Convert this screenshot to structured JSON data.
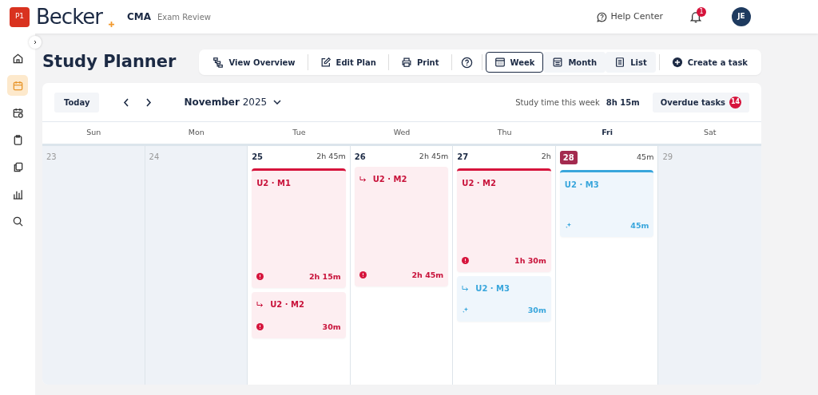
{
  "header": {
    "badge": "P1",
    "logo": "Becker",
    "product": "CMA",
    "product_subtitle": "Exam Review",
    "help": "Help Center",
    "notifications": "1",
    "avatar": "JE"
  },
  "sidebar": {
    "items": [
      {
        "selected": false
      },
      {
        "selected": true
      },
      {
        "selected": false
      },
      {
        "selected": false
      },
      {
        "selected": false
      },
      {
        "selected": false
      },
      {
        "selected": false
      }
    ]
  },
  "title": "Study Planner",
  "toolbar": [
    {
      "kind": "action",
      "label": "View Overview"
    },
    {
      "kind": "action",
      "label": "Edit Plan"
    },
    {
      "kind": "action",
      "label": "Print"
    },
    {
      "kind": "help"
    },
    {
      "kind": "view",
      "label": "Week",
      "selected": true
    },
    {
      "kind": "view",
      "label": "Month",
      "selected": false
    },
    {
      "kind": "view",
      "label": "List",
      "selected": false
    },
    {
      "kind": "create",
      "label": "Create a task"
    }
  ],
  "calendar": {
    "today_button": "Today",
    "month": "November",
    "year": "2025",
    "study_time_label": "Study time this week",
    "study_time": "8h 15m",
    "overdue_label": "Overdue tasks",
    "overdue_count": "14",
    "weekdays": [
      {
        "label": "Sun",
        "selected": false
      },
      {
        "label": "Mon",
        "selected": false
      },
      {
        "label": "Tue",
        "selected": false
      },
      {
        "label": "Wed",
        "selected": false
      },
      {
        "label": "Thu",
        "selected": false
      },
      {
        "label": "Fri",
        "selected": true
      },
      {
        "label": "Sat",
        "selected": false
      }
    ],
    "days": [
      {
        "date": "23",
        "disabled": true,
        "today": false
      },
      {
        "date": "24",
        "disabled": true,
        "today": false
      },
      {
        "date": "25",
        "disabled": false,
        "today": false,
        "total": "2h 45m",
        "tasks": [
          {
            "kind": "overdue",
            "title": "U2 · M1",
            "duration": "2h 15m",
            "carried_over": false,
            "started": true
          },
          {
            "kind": "overdue",
            "title": "U2 · M2",
            "duration": "30m",
            "carried_over": true,
            "started": false
          }
        ]
      },
      {
        "date": "26",
        "disabled": false,
        "today": false,
        "total": "2h 45m",
        "tasks": [
          {
            "kind": "overdue",
            "title": "U2 · M2",
            "duration": "2h 45m",
            "carried_over": true,
            "started": false
          }
        ]
      },
      {
        "date": "27",
        "disabled": false,
        "today": false,
        "total": "2h",
        "tasks": [
          {
            "kind": "overdue",
            "title": "U2 · M2",
            "duration": "1h 30m",
            "carried_over": false,
            "started": true
          },
          {
            "kind": "upcoming",
            "title": "U2 · M3",
            "duration": "30m",
            "carried_over": true,
            "started": false
          }
        ]
      },
      {
        "date": "28",
        "disabled": false,
        "today": true,
        "total": "45m",
        "tasks": [
          {
            "kind": "upcoming",
            "title": "U2 · M3",
            "duration": "45m",
            "carried_over": false,
            "started": true
          }
        ]
      },
      {
        "date": "29",
        "disabled": true,
        "today": false
      }
    ]
  }
}
